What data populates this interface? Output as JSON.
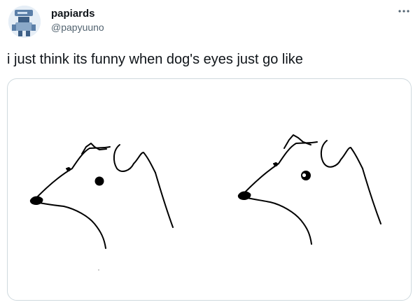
{
  "tweet": {
    "author_name": "papiards",
    "author_handle": "@papyuuno",
    "text": "i just think its funny when dog's eyes just go like"
  },
  "icons": {
    "more": "more-horizontal-icon",
    "avatar": "robot-avatar-image"
  },
  "colors": {
    "text": "#0f1419",
    "secondary_text": "#536471",
    "border": "#cfd9de",
    "more_icon": "#536471"
  }
}
